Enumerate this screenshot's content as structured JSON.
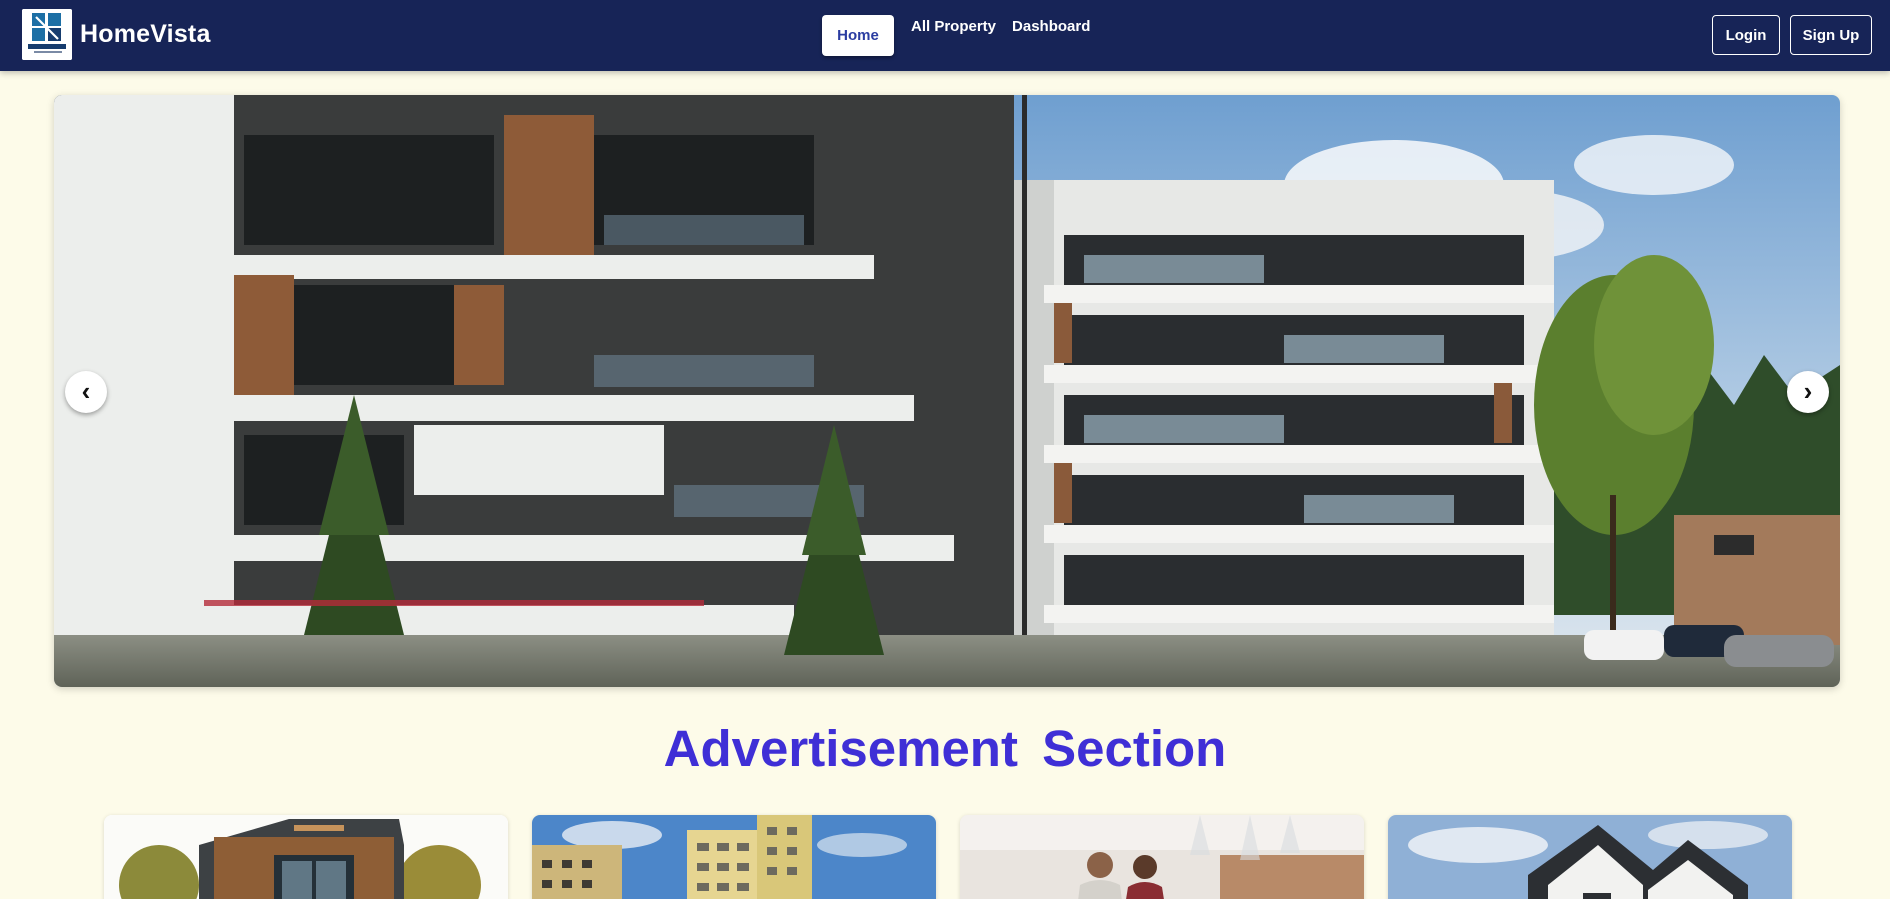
{
  "navbar": {
    "brand_name": "HomeVista",
    "logo_icon": "homevista-logo-icon",
    "links": {
      "home": "Home",
      "all_property": "All Property",
      "dashboard": "Dashboard"
    },
    "auth": {
      "login": "Login",
      "signup": "Sign Up"
    }
  },
  "hero": {
    "image_icon": "apartment-building-photo",
    "prev_arrow": "‹",
    "next_arrow": "›"
  },
  "advertisement": {
    "title": "Advertisement  Section",
    "cards": [
      {
        "image_icon": "modern-house-photo"
      },
      {
        "image_icon": "apartment-tower-photo"
      },
      {
        "image_icon": "agents-meeting-photo"
      },
      {
        "image_icon": "suburban-house-photo"
      }
    ]
  },
  "colors": {
    "navbar_bg": "#172457",
    "page_bg": "#fdfbe9",
    "title_accent": "#3f2fd6",
    "home_text": "#2b3da1"
  }
}
